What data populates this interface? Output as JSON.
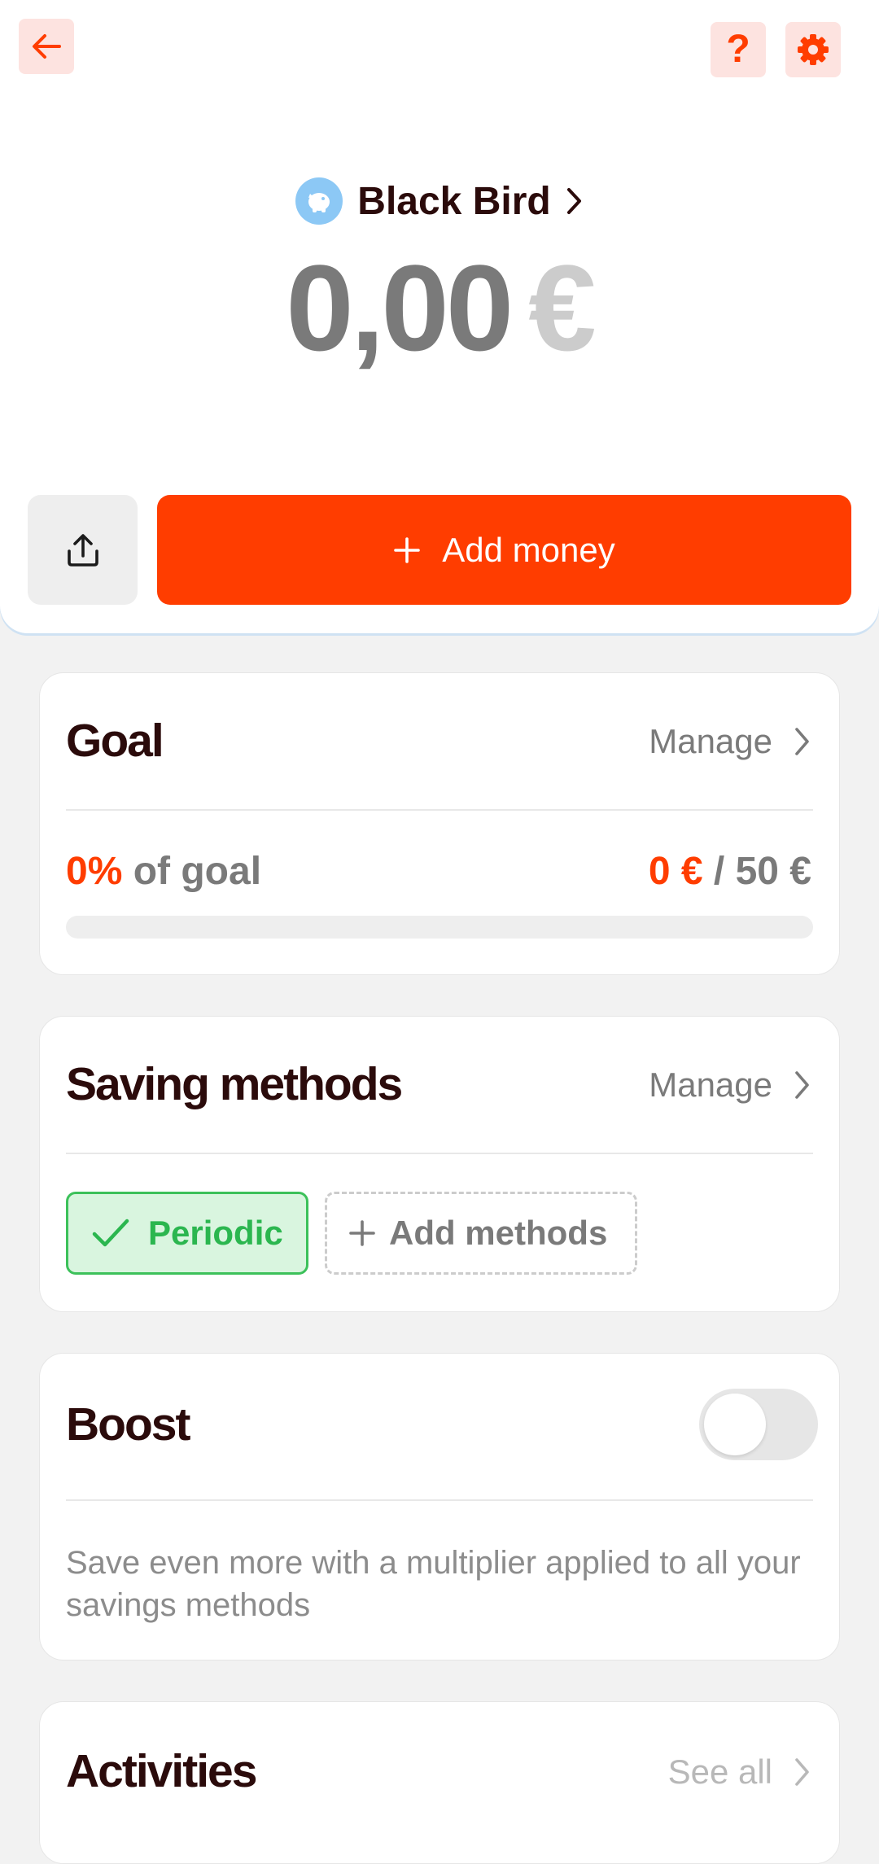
{
  "header": {
    "back_icon": "arrow-left-icon",
    "help_label": "?",
    "settings_icon": "gear-icon",
    "accent_color": "#ff3d00"
  },
  "account": {
    "name": "Black Bird",
    "avatar_icon": "piggy-bank-icon"
  },
  "balance": {
    "amount": "0,00",
    "currency": "€"
  },
  "actions": {
    "share_icon": "share-icon",
    "add_money_label": "Add money"
  },
  "goal": {
    "title": "Goal",
    "manage_label": "Manage",
    "percent": "0%",
    "percent_suffix": " of goal",
    "current": "0 €",
    "separator": " / ",
    "target": "50 €",
    "progress_fraction": 0
  },
  "saving_methods": {
    "title": "Saving methods",
    "manage_label": "Manage",
    "methods": [
      {
        "label": "Periodic",
        "active": true
      }
    ],
    "add_label": "Add methods"
  },
  "boost": {
    "title": "Boost",
    "enabled": false,
    "description": "Save even more with a multiplier applied to all your savings methods"
  },
  "activities": {
    "title": "Activities",
    "see_all_label": "See all"
  }
}
